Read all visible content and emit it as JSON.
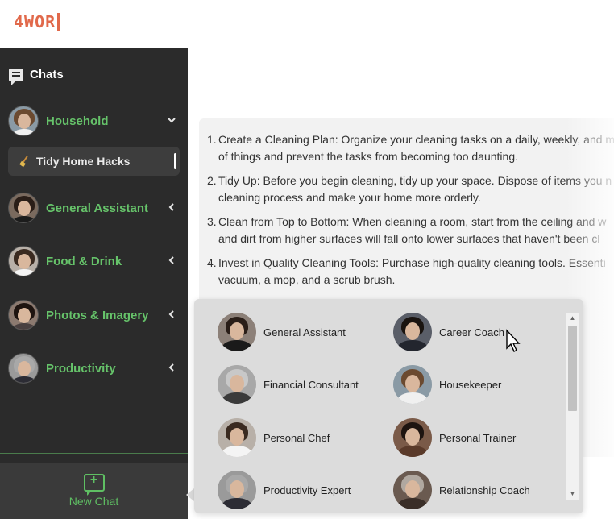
{
  "app": {
    "logo": "4WOR"
  },
  "sidebar": {
    "heading": "Chats",
    "categories": [
      {
        "label": "Household",
        "expanded": true,
        "icon": "chevron-down-icon"
      },
      {
        "label": "General Assistant",
        "expanded": false,
        "icon": "chevron-left-icon"
      },
      {
        "label": "Food & Drink",
        "expanded": false,
        "icon": "chevron-left-icon"
      },
      {
        "label": "Photos & Imagery",
        "expanded": false,
        "icon": "chevron-left-icon"
      },
      {
        "label": "Productivity",
        "expanded": false,
        "icon": "chevron-left-icon"
      }
    ],
    "sub_items": [
      {
        "label": "Tidy Home Hacks",
        "icon": "broom-icon"
      }
    ],
    "new_chat": "New Chat"
  },
  "message": {
    "items": [
      {
        "num": "1.",
        "line1": "Create a Cleaning Plan: Organize your cleaning tasks on a daily, weekly, and m",
        "line2": "of things and prevent the tasks from becoming too daunting."
      },
      {
        "num": "2.",
        "line1": "Tidy Up: Before you begin cleaning, tidy up your space. Dispose of items you n",
        "line2": "cleaning process and make your home more orderly."
      },
      {
        "num": "3.",
        "line1": "Clean from Top to Bottom: When cleaning a room, start from the ceiling and w",
        "line2": "and dirt from higher surfaces will fall onto lower surfaces that haven't been cl"
      },
      {
        "num": "4.",
        "line1": "Invest in Quality Cleaning Tools: Purchase high-quality cleaning tools. Essenti",
        "line2": "vacuum, a mop, and a scrub brush."
      }
    ]
  },
  "popup": {
    "assistants": [
      {
        "name": "General Assistant"
      },
      {
        "name": "Career Coach"
      },
      {
        "name": "Financial Consultant"
      },
      {
        "name": "Housekeeper"
      },
      {
        "name": "Personal Chef"
      },
      {
        "name": "Personal Trainer"
      },
      {
        "name": "Productivity Expert"
      },
      {
        "name": "Relationship Coach"
      }
    ]
  },
  "colors": {
    "accent_green": "#66c36a",
    "logo_orange": "#e1694b",
    "sidebar_bg": "#2b2b2b"
  }
}
